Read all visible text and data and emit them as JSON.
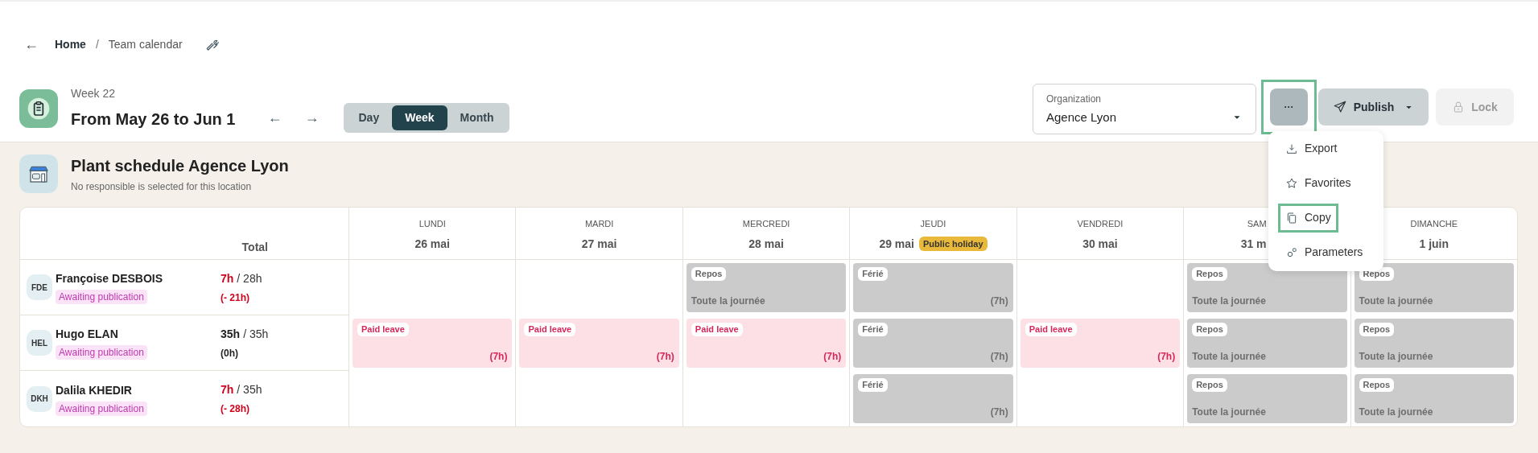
{
  "breadcrumb": {
    "back": "←",
    "home": "Home",
    "separator": "/",
    "current": "Team calendar"
  },
  "header": {
    "week": "Week 22",
    "range": "From May 26 to Jun 1",
    "prev": "←",
    "next": "→",
    "views": [
      {
        "label": "Day",
        "selected": false
      },
      {
        "label": "Week",
        "selected": true
      },
      {
        "label": "Month",
        "selected": false
      }
    ]
  },
  "organization": {
    "label": "Organization",
    "value": "Agence Lyon"
  },
  "more_button": {
    "label": "···",
    "highlighted": true
  },
  "publish_button": {
    "label": "Publish",
    "disabled": false
  },
  "lock_button": {
    "label": "Lock",
    "disabled": true
  },
  "menu": [
    {
      "kind": "export",
      "label": "Export",
      "highlighted": false
    },
    {
      "kind": "favorites",
      "label": "Favorites",
      "highlighted": false
    },
    {
      "kind": "copy",
      "label": "Copy",
      "highlighted": true
    },
    {
      "kind": "parameters",
      "label": "Parameters",
      "highlighted": false
    }
  ],
  "location": {
    "title": "Plant schedule Agence Lyon",
    "subtitle": "No responsible is selected for this location"
  },
  "table": {
    "total_label": "Total",
    "days": [
      {
        "name": "LUNDI",
        "date": "26 mai",
        "cut": false
      },
      {
        "name": "MARDI",
        "date": "27 mai",
        "cut": false
      },
      {
        "name": "MERCREDI",
        "date": "28 mai",
        "cut": false
      },
      {
        "name": "JEUDI",
        "date": "29 mai",
        "badge": "Public holiday",
        "cut": false
      },
      {
        "name": "VENDREDI",
        "date": "30 mai",
        "cut": false
      },
      {
        "name": "SAM",
        "date": "31 m",
        "cut": true
      },
      {
        "name": "DIMANCHE",
        "date": "1 juin",
        "cut": false
      }
    ],
    "employees": [
      {
        "initials": "FDE",
        "name": "Françoise DESBOIS",
        "status": "Awaiting publication",
        "done": "7h",
        "planned": "/ 28h",
        "balance": "(- 21h)",
        "deficit": true,
        "entries": [
          {
            "kind": "empty"
          },
          {
            "kind": "empty"
          },
          {
            "kind": "rest",
            "label": "Repos",
            "note": "Toute la journée"
          },
          {
            "kind": "holiday",
            "label": "Férié",
            "hours": "(7h)"
          },
          {
            "kind": "empty"
          },
          {
            "kind": "rest",
            "label": "Repos",
            "note": "Toute la journée"
          },
          {
            "kind": "rest",
            "label": "Repos",
            "note": "Toute la journée"
          }
        ]
      },
      {
        "initials": "HEL",
        "name": "Hugo ELAN",
        "status": "Awaiting publication",
        "done": "35h",
        "planned": "/ 35h",
        "balance": "(0h)",
        "deficit": false,
        "entries": [
          {
            "kind": "leave",
            "label": "Paid leave",
            "hours": "(7h)"
          },
          {
            "kind": "leave",
            "label": "Paid leave",
            "hours": "(7h)"
          },
          {
            "kind": "leave",
            "label": "Paid leave",
            "hours": "(7h)"
          },
          {
            "kind": "holiday",
            "label": "Férié",
            "hours": "(7h)"
          },
          {
            "kind": "leave",
            "label": "Paid leave",
            "hours": "(7h)"
          },
          {
            "kind": "rest",
            "label": "Repos",
            "note": "Toute la journée"
          },
          {
            "kind": "rest",
            "label": "Repos",
            "note": "Toute la journée"
          }
        ]
      },
      {
        "initials": "DKH",
        "name": "Dalila KHEDIR",
        "status": "Awaiting publication",
        "done": "7h",
        "planned": "/ 35h",
        "balance": "(- 28h)",
        "deficit": true,
        "entries": [
          {
            "kind": "empty"
          },
          {
            "kind": "empty"
          },
          {
            "kind": "empty"
          },
          {
            "kind": "holiday",
            "label": "Férié",
            "hours": "(7h)"
          },
          {
            "kind": "empty"
          },
          {
            "kind": "rest",
            "label": "Repos",
            "note": "Toute la journée"
          },
          {
            "kind": "rest",
            "label": "Repos",
            "note": "Toute la journée"
          }
        ]
      }
    ]
  }
}
